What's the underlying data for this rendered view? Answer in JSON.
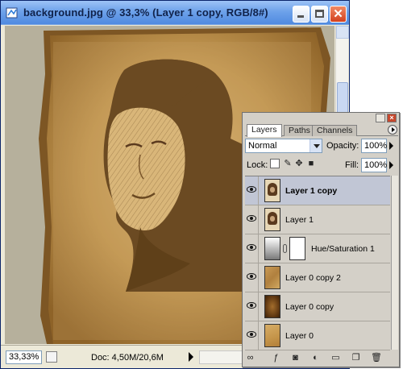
{
  "document": {
    "title": "background.jpg @ 33,3% (Layer 1 copy, RGB/8#)",
    "zoom": "33,33%",
    "doc_info": "Doc: 4,50M/20,6M"
  },
  "layers_panel": {
    "tabs": [
      {
        "label": "Layers",
        "active": true
      },
      {
        "label": "Paths",
        "active": false
      },
      {
        "label": "Channels",
        "active": false
      }
    ],
    "blend_mode": "Normal",
    "opacity_label": "Opacity:",
    "opacity_value": "100%",
    "lock_label": "Lock:",
    "fill_label": "Fill:",
    "fill_value": "100%",
    "layers": [
      {
        "name": "Layer 1 copy",
        "thumb": "portrait",
        "selected": true,
        "visible": true
      },
      {
        "name": "Layer 1",
        "thumb": "portrait",
        "selected": false,
        "visible": true
      },
      {
        "name": "Hue/Saturation 1",
        "thumb": "adjustment",
        "selected": false,
        "visible": true
      },
      {
        "name": "Layer 0 copy 2",
        "thumb": "parchment",
        "selected": false,
        "visible": true
      },
      {
        "name": "Layer 0 copy",
        "thumb": "dark",
        "selected": false,
        "visible": true
      },
      {
        "name": "Layer 0",
        "thumb": "light",
        "selected": false,
        "visible": true
      }
    ],
    "footer_icons": [
      "link-icon",
      "layer-style-icon",
      "mask-icon",
      "adjustment-layer-icon",
      "group-icon",
      "new-layer-icon",
      "trash-icon"
    ]
  },
  "colors": {
    "titlebar": "#6ea2ea",
    "parchment": "#c9a063",
    "silhouette": "#6b4a22",
    "selected_layer": "#c1c6d5"
  }
}
